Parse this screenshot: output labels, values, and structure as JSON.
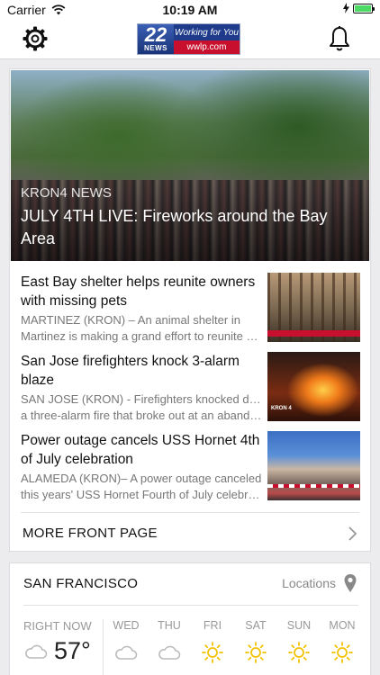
{
  "status_bar": {
    "carrier": "Carrier",
    "time": "10:19 AM",
    "battery_level": 1.0,
    "battery_color": "#4cd964"
  },
  "nav": {
    "left_icon": "gear-icon",
    "right_icon": "bell-icon",
    "logo": {
      "number": "22",
      "news": "NEWS",
      "tagline": "Working for You",
      "url": "wwlp.com"
    }
  },
  "hero": {
    "source": "KRON4 NEWS",
    "title": "JULY 4TH LIVE: Fireworks around the Bay Area"
  },
  "articles": [
    {
      "title": "East Bay shelter helps reunite owners with missing pets",
      "summary_line1": "MARTINEZ (KRON) – An animal shelter in",
      "summary_line2": "Martinez is making a grand effort to reunite o…"
    },
    {
      "title": "San Jose firefighters knock 3-alarm blaze",
      "summary_line1": "SAN JOSE (KRON) - Firefighters knocked down",
      "summary_line2": "a three-alarm fire that broke out at an abando…",
      "thumb_tag": "KRON 4"
    },
    {
      "title": "Power outage cancels USS Hornet 4th of July celebration",
      "summary_line1": "ALAMEDA (KRON)– A power outage canceled",
      "summary_line2": "this years' USS Hornet Fourth of July celebrat…"
    }
  ],
  "more": {
    "label": "MORE FRONT PAGE",
    "icon": "chevron-right-icon"
  },
  "weather": {
    "city": "SAN FRANCISCO",
    "locations_label": "Locations",
    "now_label": "RIGHT NOW",
    "now_temp": "57°",
    "now_icon": "cloud-icon",
    "days": [
      {
        "label": "WED",
        "icon": "cloud-icon"
      },
      {
        "label": "THU",
        "icon": "cloud-icon"
      },
      {
        "label": "FRI",
        "icon": "sun-icon"
      },
      {
        "label": "SAT",
        "icon": "sun-icon"
      },
      {
        "label": "SUN",
        "icon": "sun-icon"
      },
      {
        "label": "MON",
        "icon": "sun-icon"
      }
    ],
    "sun_color": "#f2c200",
    "cloud_color": "#bbbbbb"
  }
}
